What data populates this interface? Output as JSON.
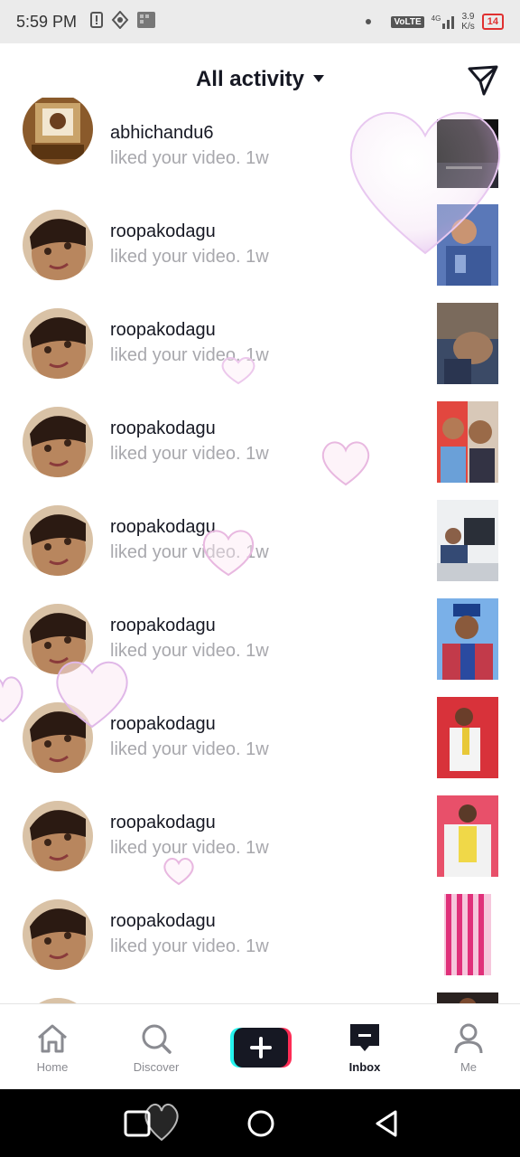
{
  "status_bar": {
    "time": "5:59 PM",
    "network_label": "VoLTE",
    "network_gen": "4G",
    "speed_value": "3.9",
    "speed_unit": "K/s",
    "battery": "14"
  },
  "header": {
    "title": "All activity",
    "send_icon": "send-icon"
  },
  "notifications": [
    {
      "username": "abhichandu6",
      "action": "liked your video.",
      "time": "1w"
    },
    {
      "username": "roopakodagu",
      "action": "liked your video.",
      "time": "1w"
    },
    {
      "username": "roopakodagu",
      "action": "liked your video.",
      "time": "1w"
    },
    {
      "username": "roopakodagu",
      "action": "liked your video.",
      "time": "1w"
    },
    {
      "username": "roopakodagu",
      "action": "liked your video.",
      "time": "1w"
    },
    {
      "username": "roopakodagu",
      "action": "liked your video.",
      "time": "1w"
    },
    {
      "username": "roopakodagu",
      "action": "liked your video.",
      "time": "1w"
    },
    {
      "username": "roopakodagu",
      "action": "liked your video.",
      "time": "1w"
    },
    {
      "username": "roopakodagu",
      "action": "liked your video.",
      "time": "1w"
    }
  ],
  "bottom_nav": {
    "tabs": [
      {
        "label": "Home",
        "icon": "home-icon",
        "active": false
      },
      {
        "label": "Discover",
        "icon": "search-icon",
        "active": false
      },
      {
        "label": "",
        "icon": "plus-icon",
        "active": false
      },
      {
        "label": "Inbox",
        "icon": "inbox-icon",
        "active": true
      },
      {
        "label": "Me",
        "icon": "profile-icon",
        "active": false
      }
    ]
  },
  "colors": {
    "text_primary": "#161823",
    "text_secondary": "#a8a8ad",
    "create_cyan": "#25f4ee",
    "create_red": "#fe2c55"
  }
}
